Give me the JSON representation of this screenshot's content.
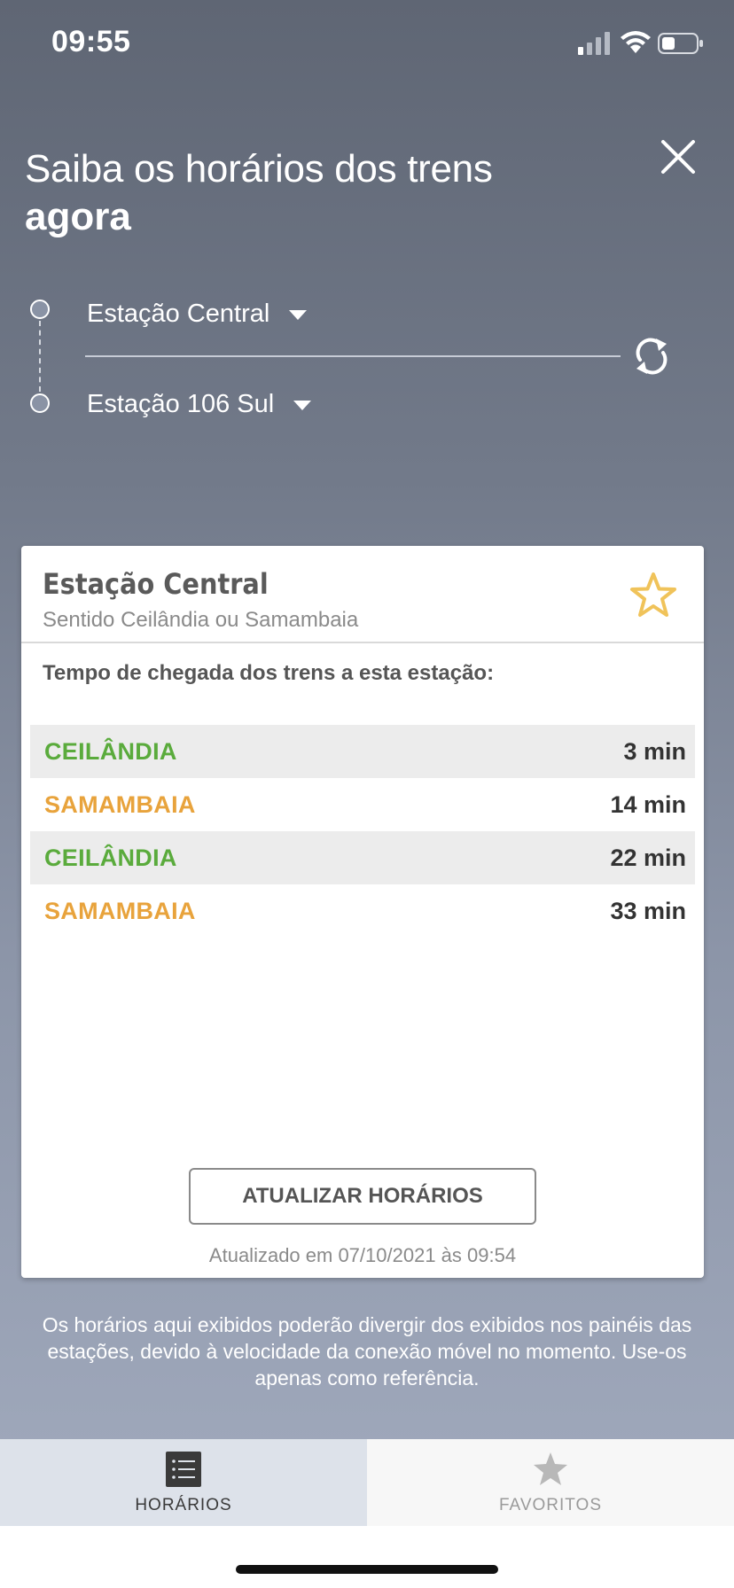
{
  "status": {
    "time": "09:55"
  },
  "header": {
    "title_light": "Saiba os horários dos trens",
    "title_bold": "agora"
  },
  "route": {
    "origin": "Estação Central",
    "destination": "Estação 106 Sul"
  },
  "card": {
    "station": "Estação Central",
    "direction": "Sentido Ceilândia ou Samambaia",
    "arrival_label": "Tempo de chegada dos trens a esta estação:",
    "arrivals": [
      {
        "destination": "CEILÂNDIA",
        "time": "3 min",
        "color": "#5aab3c"
      },
      {
        "destination": "SAMAMBAIA",
        "time": "14 min",
        "color": "#e8a33c"
      },
      {
        "destination": "CEILÂNDIA",
        "time": "22 min",
        "color": "#5aab3c"
      },
      {
        "destination": "SAMAMBAIA",
        "time": "33 min",
        "color": "#e8a33c"
      }
    ],
    "update_button": "ATUALIZAR HORÁRIOS",
    "updated_at": "Atualizado em 07/10/2021 às 09:54",
    "star_color": "#f0c35a"
  },
  "disclaimer": "Os horários aqui exibidos poderão divergir dos exibidos nos painéis das estações, devido à velocidade da conexão móvel no momento. Use-os apenas como referência.",
  "tabs": [
    {
      "label": "HORÁRIOS",
      "icon": "list-icon",
      "active": true
    },
    {
      "label": "FAVORITOS",
      "icon": "star-icon",
      "active": false
    }
  ]
}
